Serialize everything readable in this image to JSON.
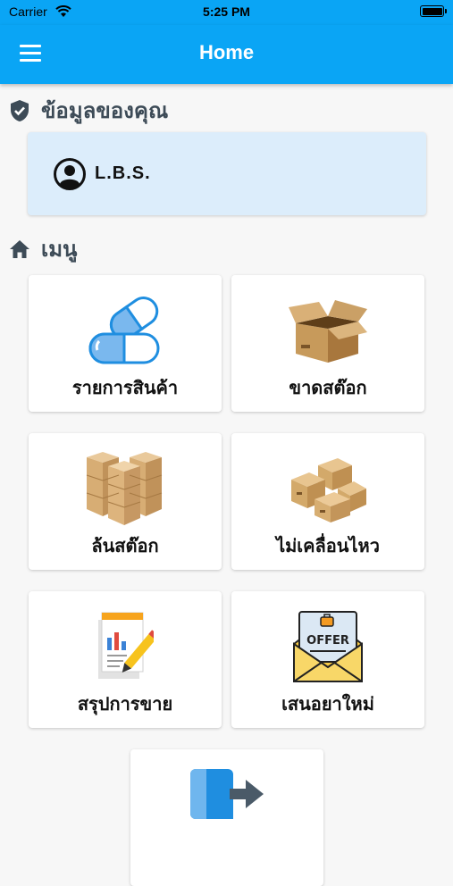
{
  "status_bar": {
    "carrier": "Carrier",
    "time": "5:25 PM"
  },
  "app_bar": {
    "title": "Home"
  },
  "profile_section": {
    "title": "ข้อมูลของคุณ",
    "user_name": "L.B.S."
  },
  "menu_section": {
    "title": "เมนู"
  },
  "menu_items": [
    {
      "label": "รายการสินค้า",
      "icon": "capsule-icon"
    },
    {
      "label": "ขาดสต๊อก",
      "icon": "open-box-icon"
    },
    {
      "label": "ล้นสต๊อก",
      "icon": "stacked-boxes-icon"
    },
    {
      "label": "ไม่เคลื่อนไหว",
      "icon": "boxes-pile-icon"
    },
    {
      "label": "สรุปการขาย",
      "icon": "sales-report-icon"
    },
    {
      "label": "เสนอยาใหม่",
      "icon": "offer-envelope-icon"
    },
    {
      "label": "",
      "icon": "logout-icon"
    }
  ],
  "colors": {
    "primary": "#0aa5f5",
    "profile_card_bg": "#dcedfb",
    "section_text": "#3d4b57"
  }
}
